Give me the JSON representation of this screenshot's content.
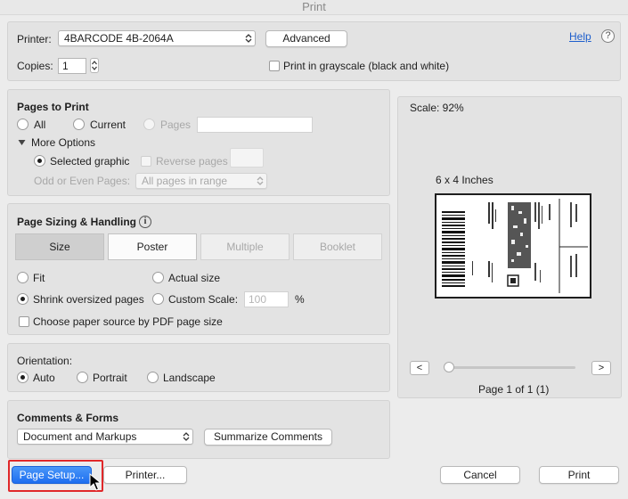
{
  "window": {
    "title": "Print"
  },
  "header": {
    "printer_label": "Printer:",
    "printer_value": "4BARCODE 4B-2064A",
    "advanced_button": "Advanced",
    "help_link": "Help",
    "help_icon_glyph": "?",
    "copies_label": "Copies:",
    "copies_value": "1",
    "grayscale_label": "Print in grayscale (black and white)"
  },
  "pages_to_print": {
    "title": "Pages to Print",
    "all": "All",
    "current": "Current",
    "pages": "Pages",
    "more_options": "More Options",
    "selected_graphic": "Selected graphic",
    "reverse_pages": "Reverse pages",
    "odd_even_label": "Odd or Even Pages:",
    "odd_even_value": "All pages in range"
  },
  "sizing": {
    "title": "Page Sizing & Handling",
    "info_glyph": "i",
    "tabs": [
      "Size",
      "Poster",
      "Multiple",
      "Booklet"
    ],
    "fit": "Fit",
    "actual_size": "Actual size",
    "shrink": "Shrink oversized pages",
    "custom_scale": "Custom Scale:",
    "custom_scale_value": "100",
    "percent": "%",
    "paper_source": "Choose paper source by PDF page size"
  },
  "orientation": {
    "title": "Orientation:",
    "auto": "Auto",
    "portrait": "Portrait",
    "landscape": "Landscape"
  },
  "comments": {
    "title": "Comments & Forms",
    "value": "Document and Markups",
    "summarize_button": "Summarize Comments"
  },
  "preview": {
    "scale": "Scale:  92%",
    "paper_size": "6 x 4 Inches",
    "prev": "<",
    "next": ">",
    "page_info": "Page 1 of 1 (1)"
  },
  "footer": {
    "page_setup": "Page Setup...",
    "printer": "Printer...",
    "cancel": "Cancel",
    "print": "Print"
  }
}
